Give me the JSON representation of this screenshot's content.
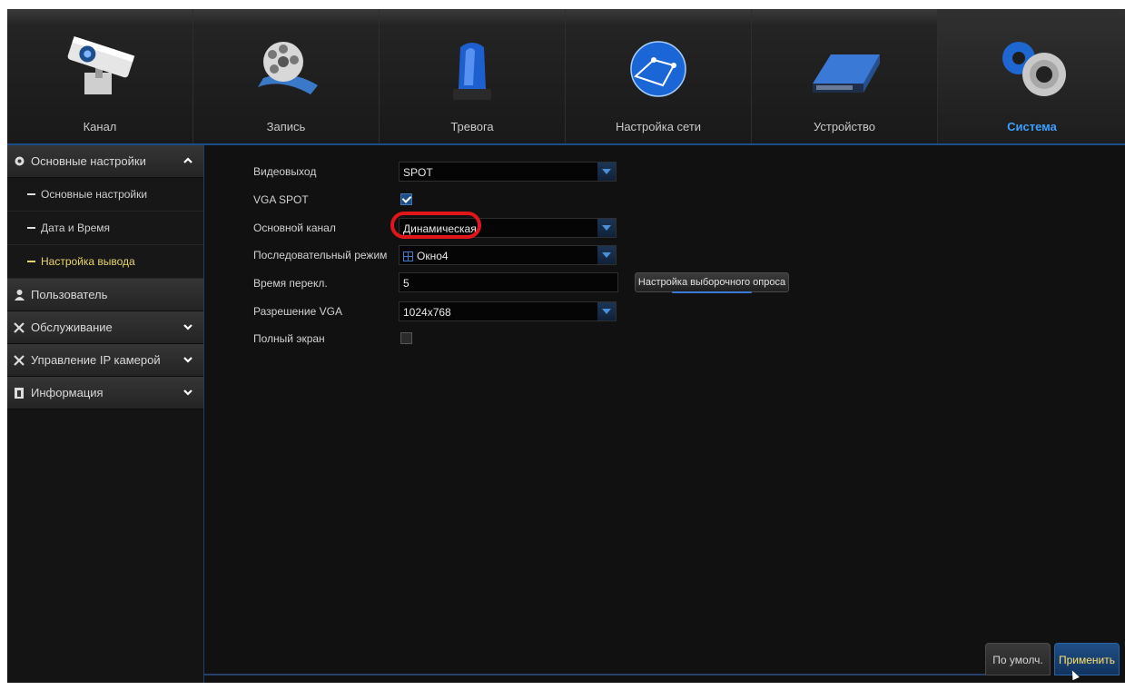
{
  "colors": {
    "accent": "#3aa0ff",
    "active_submenu": "#e6d46a",
    "highlight_ring": "#e0161a",
    "apply_text": "#ffe066"
  },
  "tabs": [
    {
      "label": "Канал",
      "icon": "camera-icon"
    },
    {
      "label": "Запись",
      "icon": "film-reel-icon"
    },
    {
      "label": "Тревога",
      "icon": "alarm-siren-icon"
    },
    {
      "label": "Настройка сети",
      "icon": "globe-network-icon"
    },
    {
      "label": "Устройство",
      "icon": "hard-drive-icon"
    },
    {
      "label": "Система",
      "icon": "gears-icon",
      "active": true
    }
  ],
  "sidebar": {
    "sections": [
      {
        "label": "Основные настройки",
        "icon": "gear-icon",
        "expanded": true
      },
      {
        "label": "Пользователь",
        "icon": "user-icon"
      },
      {
        "label": "Обслуживание",
        "icon": "tools-icon"
      },
      {
        "label": "Управление IP камерой",
        "icon": "tools-icon"
      },
      {
        "label": "Информация",
        "icon": "info-icon"
      }
    ],
    "subitems": [
      {
        "label": "Основные настройки"
      },
      {
        "label": "Дата и Время"
      },
      {
        "label": "Настройка вывода",
        "active": true
      }
    ]
  },
  "form": {
    "video_out": {
      "label": "Видеовыход",
      "value": "SPOT"
    },
    "vga_spot": {
      "label": "VGA SPOT",
      "checked": true
    },
    "main_channel": {
      "label": "Основной канал",
      "value": "Динамическая"
    },
    "sequence_mode": {
      "label": "Последовательный режим",
      "value": "Окно4"
    },
    "switch_time": {
      "label": "Время перекл.",
      "value": "5"
    },
    "poll_button": "Настройка выборочного опроса",
    "vga_resolution": {
      "label": "Разрешение VGA",
      "value": "1024x768"
    },
    "fullscreen": {
      "label": "Полный экран",
      "checked": false
    }
  },
  "footer": {
    "default_label": "По умолч.",
    "apply_label": "Применить"
  }
}
